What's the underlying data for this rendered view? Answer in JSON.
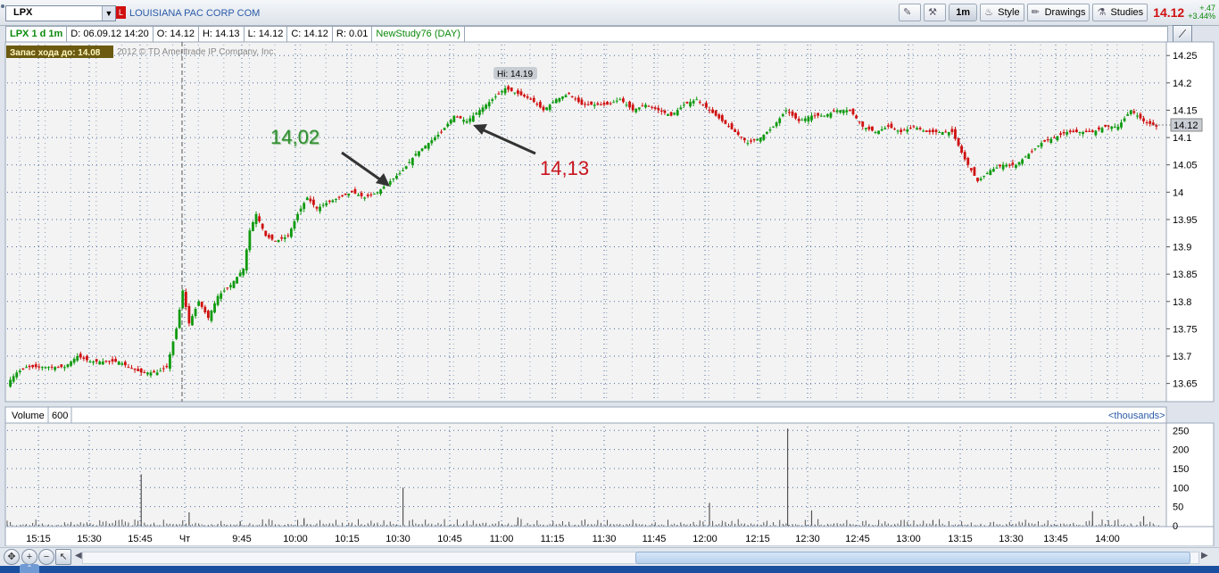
{
  "toolbar": {
    "symbol": "LPX",
    "badge": "L",
    "company": "LOUISIANA PAC CORP COM",
    "timeframe": "1m",
    "style_label": "Style",
    "drawings_label": "Drawings",
    "studies_label": "Studies",
    "last_price": "14.12",
    "change_abs": "+.47",
    "change_pct": "+3.44%"
  },
  "infobar": {
    "title": "LPX 1 d 1m",
    "date": "D: 06.09.12 14:20",
    "open": "O: 14.12",
    "high": "H: 14.13",
    "low": "L: 14.12",
    "close": "C: 14.12",
    "range": "R: 0.01",
    "study": "NewStudy76 (DAY)"
  },
  "chart_labels": {
    "reserve_label": "Запас хода до: 14.08",
    "copyright": "2012 © TD Ameritrade IP Company, Inc.",
    "hi_label": "Hi: 14.19",
    "current_price_tag": "14.12",
    "annotation_green": "14,02",
    "annotation_red": "14,13",
    "volume_label": "Volume",
    "volume_period": "600",
    "volume_units": "<thousands>"
  },
  "colors": {
    "up": "#0f9a0f",
    "down": "#d01010",
    "grid": "#4a6a9a",
    "panel_bg": "#f3f3f3",
    "annotation_green": "#2f8f2f",
    "annotation_red": "#c8141e"
  },
  "icons": {
    "symbol_dropdown": "chevron-down-icon",
    "nav_pan": "pan-icon",
    "nav_zoom_in": "zoom-in-icon",
    "nav_zoom_out": "zoom-out-icon",
    "nav_pointer": "pointer-icon",
    "side": "chart-settings-icon"
  },
  "chart_data": {
    "type": "candlestick",
    "price_axis": {
      "ticks": [
        "14.25",
        "14.2",
        "14.15",
        "14.1",
        "14.05",
        "14",
        "13.95",
        "13.9",
        "13.85",
        "13.8",
        "13.75",
        "13.7",
        "13.65"
      ],
      "ylim": [
        13.62,
        14.27
      ]
    },
    "volume_axis": {
      "ticks": [
        "250",
        "200",
        "150",
        "100",
        "50",
        "0"
      ],
      "ylim": [
        0,
        260
      ]
    },
    "time_axis": {
      "ticks": [
        "15:15",
        "15:30",
        "15:45",
        "Чт",
        "9:45",
        "10:00",
        "10:15",
        "10:30",
        "10:45",
        "11:00",
        "11:15",
        "11:30",
        "11:45",
        "12:00",
        "12:15",
        "12:30",
        "12:45",
        "13:00",
        "13:15",
        "13:30",
        "13:45",
        "14:00"
      ]
    },
    "price_path": [
      [
        0,
        13.65
      ],
      [
        3,
        13.67
      ],
      [
        6,
        13.68
      ],
      [
        10,
        13.68
      ],
      [
        15,
        13.68
      ],
      [
        18,
        13.68
      ],
      [
        22,
        13.7
      ],
      [
        26,
        13.69
      ],
      [
        30,
        13.69
      ],
      [
        35,
        13.69
      ],
      [
        38,
        13.68
      ],
      [
        42,
        13.67
      ],
      [
        47,
        13.67
      ],
      [
        50,
        13.68
      ],
      [
        53,
        13.75
      ],
      [
        55,
        13.82
      ],
      [
        57,
        13.76
      ],
      [
        60,
        13.8
      ],
      [
        63,
        13.77
      ],
      [
        66,
        13.81
      ],
      [
        70,
        13.83
      ],
      [
        74,
        13.86
      ],
      [
        76,
        13.93
      ],
      [
        78,
        13.96
      ],
      [
        81,
        13.92
      ],
      [
        84,
        13.91
      ],
      [
        88,
        13.92
      ],
      [
        91,
        13.96
      ],
      [
        94,
        13.99
      ],
      [
        97,
        13.97
      ],
      [
        100,
        13.98
      ],
      [
        104,
        13.99
      ],
      [
        108,
        14.0
      ],
      [
        112,
        13.99
      ],
      [
        116,
        14.0
      ],
      [
        120,
        14.02
      ],
      [
        124,
        14.04
      ],
      [
        128,
        14.07
      ],
      [
        132,
        14.09
      ],
      [
        136,
        14.11
      ],
      [
        140,
        14.14
      ],
      [
        144,
        14.13
      ],
      [
        148,
        14.15
      ],
      [
        152,
        14.17
      ],
      [
        156,
        14.19
      ],
      [
        160,
        14.18
      ],
      [
        164,
        14.17
      ],
      [
        168,
        14.15
      ],
      [
        172,
        14.17
      ],
      [
        176,
        14.18
      ],
      [
        180,
        14.16
      ],
      [
        184,
        14.16
      ],
      [
        188,
        14.16
      ],
      [
        192,
        14.17
      ],
      [
        196,
        14.15
      ],
      [
        200,
        14.16
      ],
      [
        204,
        14.15
      ],
      [
        208,
        14.14
      ],
      [
        212,
        14.16
      ],
      [
        216,
        14.17
      ],
      [
        220,
        14.15
      ],
      [
        224,
        14.13
      ],
      [
        228,
        14.11
      ],
      [
        232,
        14.09
      ],
      [
        236,
        14.1
      ],
      [
        240,
        14.12
      ],
      [
        244,
        14.15
      ],
      [
        248,
        14.13
      ],
      [
        252,
        14.14
      ],
      [
        256,
        14.14
      ],
      [
        260,
        14.15
      ],
      [
        264,
        14.15
      ],
      [
        268,
        14.12
      ],
      [
        272,
        14.11
      ],
      [
        276,
        14.12
      ],
      [
        280,
        14.11
      ],
      [
        284,
        14.12
      ],
      [
        288,
        14.11
      ],
      [
        292,
        14.11
      ],
      [
        296,
        14.11
      ],
      [
        300,
        14.06
      ],
      [
        304,
        14.02
      ],
      [
        308,
        14.04
      ],
      [
        312,
        14.05
      ],
      [
        316,
        14.05
      ],
      [
        320,
        14.07
      ],
      [
        324,
        14.09
      ],
      [
        328,
        14.1
      ],
      [
        332,
        14.11
      ],
      [
        336,
        14.11
      ],
      [
        340,
        14.11
      ],
      [
        344,
        14.12
      ],
      [
        348,
        14.12
      ],
      [
        352,
        14.15
      ],
      [
        356,
        14.13
      ],
      [
        360,
        14.12
      ]
    ],
    "volume_spikes": [
      [
        42,
        135
      ],
      [
        57,
        35
      ],
      [
        73,
        12
      ],
      [
        93,
        20
      ],
      [
        124,
        100
      ],
      [
        160,
        22
      ],
      [
        220,
        60
      ],
      [
        247,
        255
      ],
      [
        252,
        40
      ],
      [
        290,
        15
      ],
      [
        340,
        38
      ],
      [
        356,
        25
      ]
    ]
  }
}
